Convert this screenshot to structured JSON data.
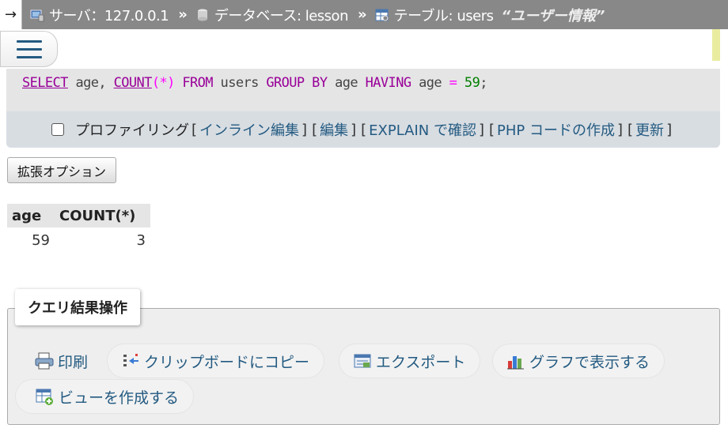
{
  "breadcrumb": {
    "arrow": "→",
    "server_label": "サーバ：127.0.0.1",
    "sep": "»",
    "database_label": "データベース: lesson",
    "table_label": "テーブル: users",
    "table_comment": "“ユーザー情報”"
  },
  "sql": {
    "select": "SELECT",
    "col1": " age, ",
    "count": "COUNT",
    "paren_open": "(",
    "star": "*",
    "paren_close": ")",
    "from": " FROM",
    "table": " users ",
    "group_by": "GROUP BY",
    "col2": " age ",
    "having": "HAVING",
    "col3": " age ",
    "eq": "=",
    "value": " 59",
    "semicolon": ";"
  },
  "sql_actions": {
    "profiling_label": "プロファイリング",
    "inline_edit": "インライン編集",
    "edit": "編集",
    "explain": "EXPLAIN で確認",
    "php_code": "PHP コードの作成",
    "refresh": "更新"
  },
  "options_button": "拡張オプション",
  "results": {
    "headers": [
      "age",
      "COUNT(*)"
    ],
    "rows": [
      [
        "59",
        "3"
      ]
    ]
  },
  "operations": {
    "legend": "クエリ結果操作",
    "print": "印刷",
    "copy": "クリップボードにコピー",
    "export": "エクスポート",
    "chart": "グラフで表示する",
    "create_view": "ビューを作成する"
  }
}
